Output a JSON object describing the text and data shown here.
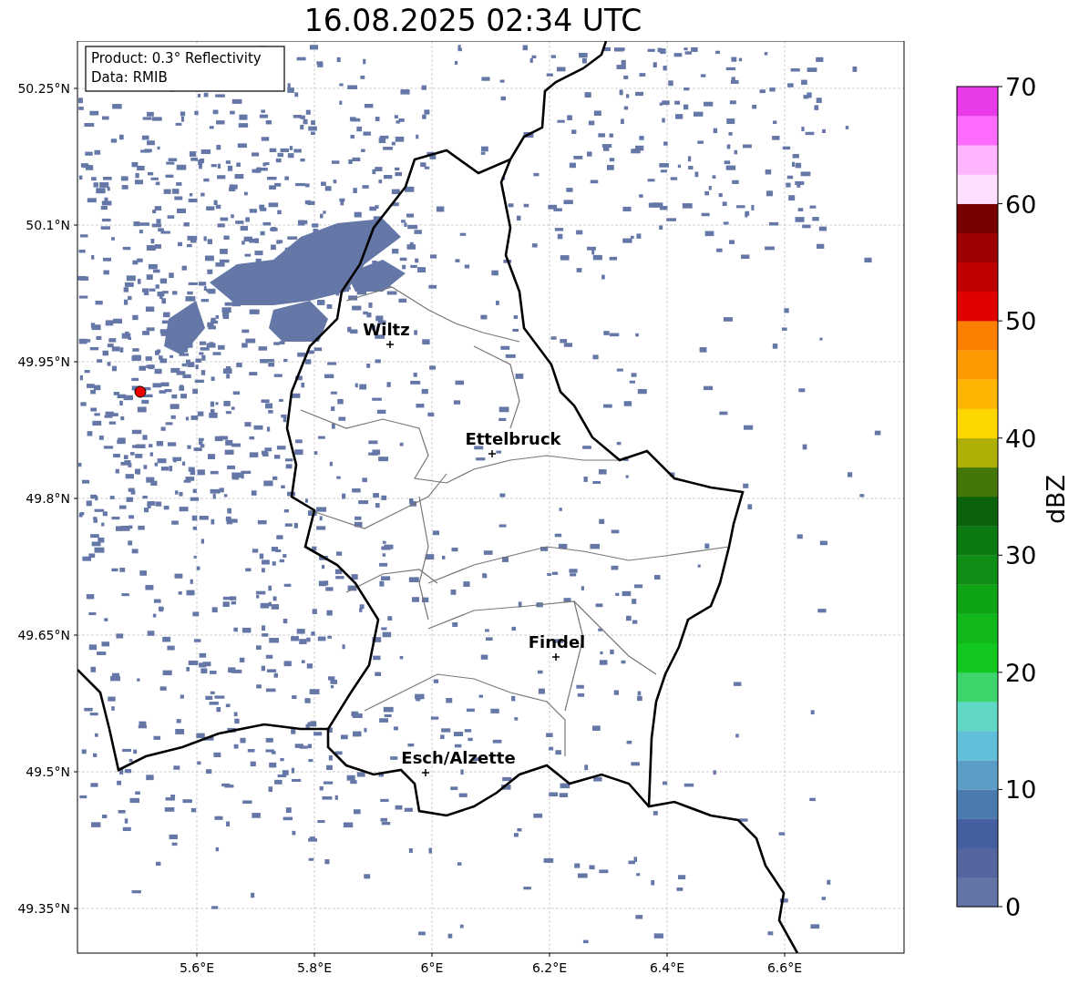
{
  "title": "16.08.2025 02:34 UTC",
  "info_box": [
    "Product: 0.3° Reflectivity",
    "Data: RMIB"
  ],
  "map": {
    "yticks": [
      "50.25°N",
      "50.1°N",
      "49.95°N",
      "49.8°N",
      "49.65°N",
      "49.5°N",
      "49.35°N"
    ],
    "xticks": [
      "5.6°E",
      "5.8°E",
      "6°E",
      "6.2°E",
      "6.4°E",
      "6.6°E"
    ],
    "cities": [
      {
        "name": "Wiltz"
      },
      {
        "name": "Ettelbruck"
      },
      {
        "name": "Findel"
      },
      {
        "name": "Esch/Alzette"
      }
    ]
  },
  "colorbar": {
    "label": "dBZ",
    "ticks": [
      "70",
      "60",
      "50",
      "40",
      "30",
      "20",
      "10",
      "0"
    ],
    "bands": [
      {
        "color": "#6474a6"
      },
      {
        "color": "#54659f"
      },
      {
        "color": "#4460a0"
      },
      {
        "color": "#4a7aae"
      },
      {
        "color": "#5a9dc6"
      },
      {
        "color": "#62bfd9"
      },
      {
        "color": "#60d8c4"
      },
      {
        "color": "#3dd46c"
      },
      {
        "color": "#12c81e"
      },
      {
        "color": "#10b81a"
      },
      {
        "color": "#0fa416"
      },
      {
        "color": "#0e8e14"
      },
      {
        "color": "#0c7a10"
      },
      {
        "color": "#0a620c"
      },
      {
        "color": "#44760a"
      },
      {
        "color": "#aeb008"
      },
      {
        "color": "#fdd600"
      },
      {
        "color": "#fdb500"
      },
      {
        "color": "#fd9900"
      },
      {
        "color": "#fd7f00"
      },
      {
        "color": "#e00000"
      },
      {
        "color": "#be0000"
      },
      {
        "color": "#9c0000"
      },
      {
        "color": "#760000"
      },
      {
        "color": "#fee0fe"
      },
      {
        "color": "#feb4fe"
      },
      {
        "color": "#fd6cfd"
      },
      {
        "color": "#e93ae9"
      }
    ]
  }
}
